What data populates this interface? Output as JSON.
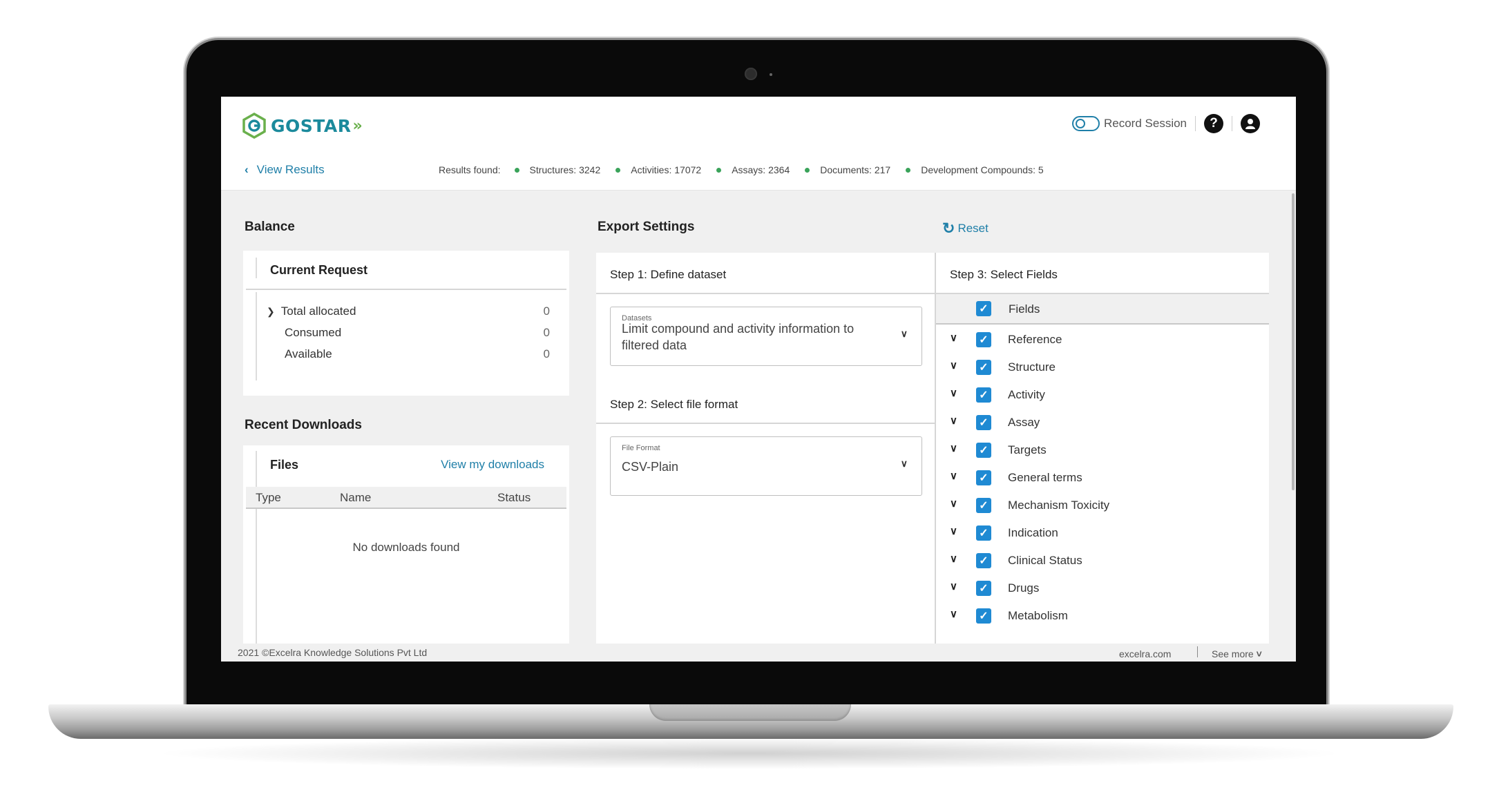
{
  "header": {
    "logo_text": "GOSTAR",
    "record_session_label": "Record Session",
    "help_icon": "question-circle-icon",
    "user_icon": "user-circle-icon"
  },
  "results_bar": {
    "back_label": "View Results",
    "results_label": "Results found:",
    "stats": [
      "Structures: 3242",
      "Activities: 17072",
      "Assays: 2364",
      "Documents: 217",
      "Development Compounds: 5"
    ]
  },
  "balance": {
    "title": "Balance",
    "card_title": "Current Request",
    "rows": [
      {
        "label": "Total allocated",
        "value": "0"
      },
      {
        "label": "Consumed",
        "value": "0"
      },
      {
        "label": "Available",
        "value": "0"
      }
    ]
  },
  "recent_downloads": {
    "title": "Recent Downloads",
    "card_title": "Files",
    "view_link": "View my downloads",
    "columns": [
      "Type",
      "Name",
      "Status"
    ],
    "empty_text": "No downloads found"
  },
  "export_settings": {
    "title": "Export Settings",
    "reset_label": "Reset",
    "step1": {
      "title": "Step 1: Define dataset",
      "caption": "Datasets",
      "value_line1": "Limit compound and activity information to",
      "value_line2": "filtered data"
    },
    "step2": {
      "title": "Step 2: Select file format",
      "caption": "File Format",
      "value": "CSV-Plain"
    },
    "step3": {
      "title": "Step 3: Select Fields",
      "header_label": "Fields",
      "fields": [
        "Reference",
        "Structure",
        "Activity",
        "Assay",
        "Targets",
        "General terms",
        "Mechanism Toxicity",
        "Indication",
        "Clinical Status",
        "Drugs",
        "Metabolism"
      ]
    }
  },
  "footer": {
    "copyright": "2021 ©Excelra Knowledge Solutions Pvt Ltd",
    "site": "excelra.com",
    "see_more": "See more"
  },
  "colors": {
    "brand_teal": "#1b8a9c",
    "brand_green": "#6ab04c",
    "link_blue": "#1f7fa8",
    "checkbox_blue": "#1f8ad3",
    "status_dot_green": "#3aa35a"
  }
}
